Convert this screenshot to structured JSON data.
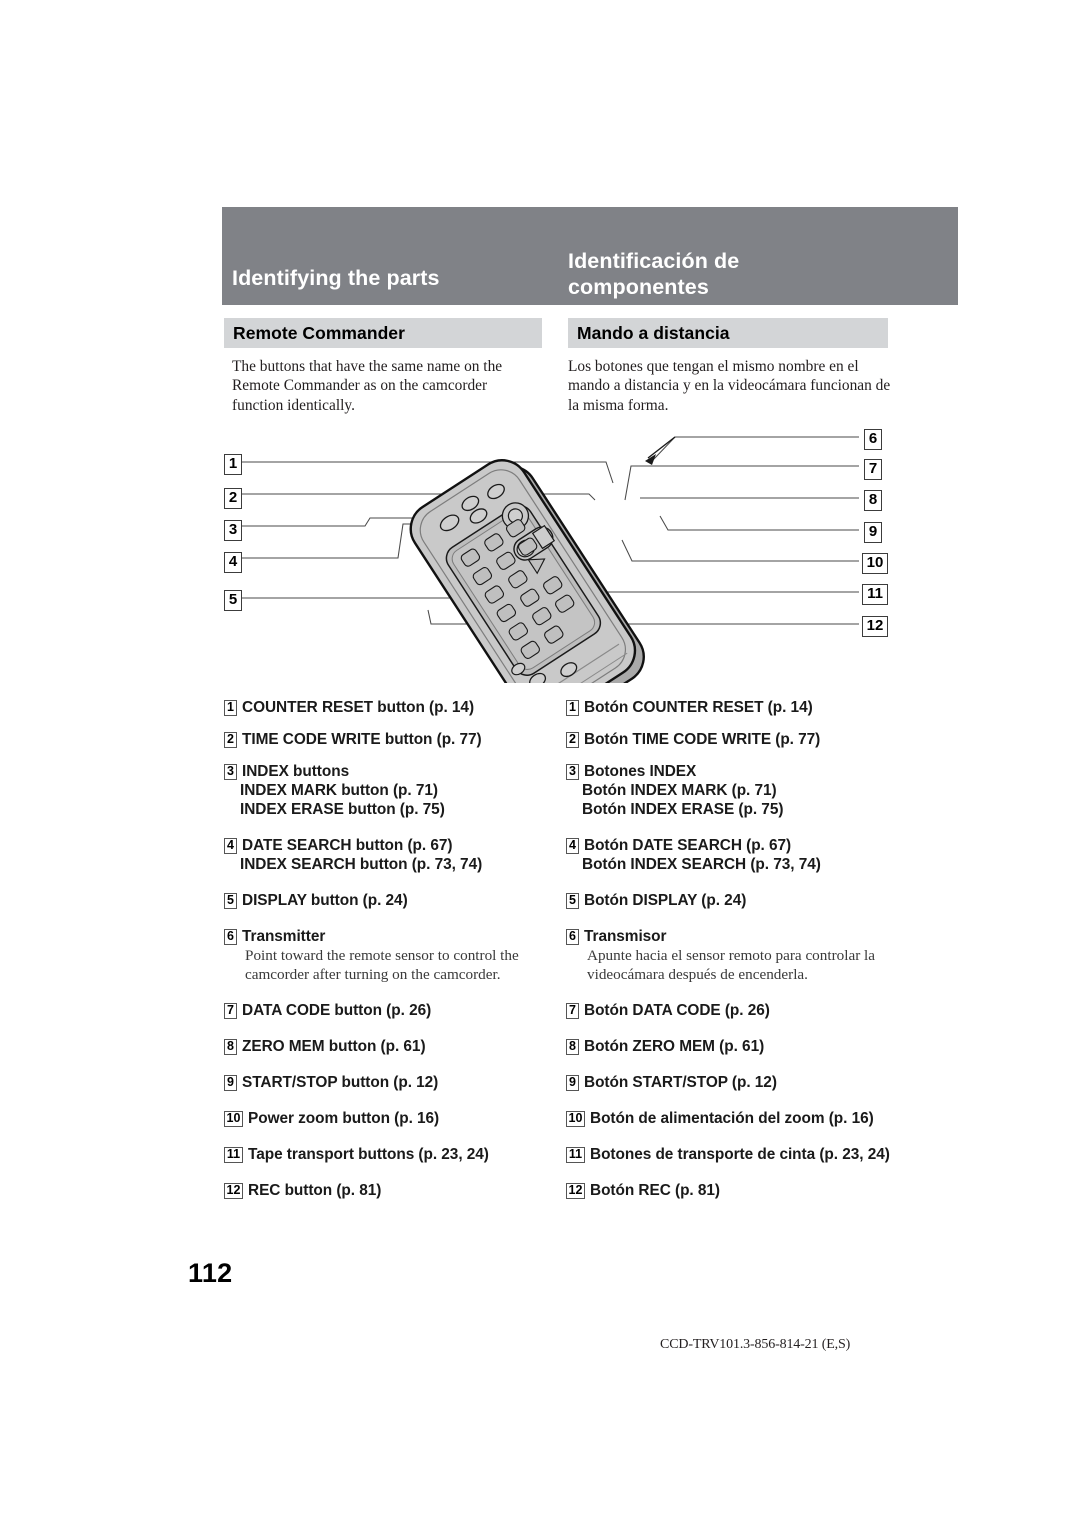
{
  "header": {
    "title_en": "Identifying the parts",
    "title_es": "Identificación de\ncomponentes",
    "subhead_en": "Remote Commander",
    "subhead_es": "Mando a distancia"
  },
  "intro": {
    "en": "The buttons that have the same name on the Remote Commander as on the camcorder function identically.",
    "es": "Los botones que tengan el mismo nombre en el mando a distancia y en la videocámara funcionan de la misma forma."
  },
  "diagram": {
    "alt": "Remote Commander illustration with numbered callouts",
    "left_markers": [
      "1",
      "2",
      "3",
      "4",
      "5"
    ],
    "right_markers": [
      "6",
      "7",
      "8",
      "9",
      "10",
      "11",
      "12"
    ]
  },
  "list_en": [
    {
      "num": "1",
      "text": "COUNTER RESET button (p. 14)"
    },
    {
      "num": "2",
      "text": "TIME CODE WRITE button (p. 77)"
    },
    {
      "num": "3",
      "text": "INDEX buttons",
      "sublines": [
        "INDEX MARK button (p. 71)",
        "INDEX ERASE button (p. 75)"
      ]
    },
    {
      "num": "4",
      "text": "DATE SEARCH button (p. 67)",
      "sublines": [
        "INDEX SEARCH button (p. 73, 74)"
      ]
    },
    {
      "num": "5",
      "text": "DISPLAY button (p. 24)"
    },
    {
      "num": "6",
      "text": "Transmitter",
      "desc": "Point toward the remote sensor to control the camcorder after turning on the camcorder."
    },
    {
      "num": "7",
      "text": "DATA CODE button (p. 26)"
    },
    {
      "num": "8",
      "text": "ZERO MEM button (p. 61)"
    },
    {
      "num": "9",
      "text": "START/STOP button (p. 12)"
    },
    {
      "num": "10",
      "text": "Power zoom button (p. 16)"
    },
    {
      "num": "11",
      "text": "Tape transport buttons (p. 23, 24)"
    },
    {
      "num": "12",
      "text": "REC button (p. 81)"
    }
  ],
  "list_es": [
    {
      "num": "1",
      "text": "Botón COUNTER RESET (p. 14)"
    },
    {
      "num": "2",
      "text": "Botón TIME CODE WRITE (p. 77)"
    },
    {
      "num": "3",
      "text": "Botones INDEX",
      "sublines": [
        "Botón INDEX MARK (p. 71)",
        "Botón INDEX ERASE (p. 75)"
      ]
    },
    {
      "num": "4",
      "text": "Botón DATE SEARCH (p. 67)",
      "sublines": [
        "Botón INDEX SEARCH (p. 73, 74)"
      ]
    },
    {
      "num": "5",
      "text": "Botón DISPLAY (p. 24)"
    },
    {
      "num": "6",
      "text": "Transmisor",
      "desc": "Apunte hacia el sensor remoto para controlar la videocámara después de encenderla."
    },
    {
      "num": "7",
      "text": "Botón DATA CODE (p. 26)"
    },
    {
      "num": "8",
      "text": "Botón ZERO MEM (p. 61)"
    },
    {
      "num": "9",
      "text": "Botón START/STOP (p. 12)"
    },
    {
      "num": "10",
      "text": "Botón de alimentación del zoom (p. 16)"
    },
    {
      "num": "11",
      "text": "Botones de transporte de cinta (p. 23, 24)"
    },
    {
      "num": "12",
      "text": "Botón REC (p. 81)"
    }
  ],
  "page_number": "112",
  "footer": "CCD-TRV101.3-856-814-21 (E,S)",
  "colors": {
    "header_band": "#808287",
    "subhead_band": "#d3d5d7",
    "text": "#1a1a1a"
  }
}
